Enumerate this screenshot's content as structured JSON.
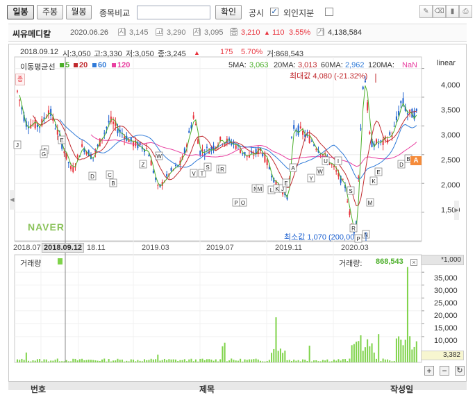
{
  "toolbar": {
    "period_daily": "일봉",
    "period_weekly": "주봉",
    "period_monthly": "월봉",
    "compare_label": "종목비교",
    "confirm_label": "확인",
    "disclosure_label": "공시",
    "foreign_label": "외인지분",
    "disclosure_check": "✓"
  },
  "info": {
    "stock_name": "씨유메디칼",
    "date": "2020.06.26",
    "open_badge": "시",
    "open": "3,145",
    "high_badge": "고",
    "high": "3,290",
    "low_badge": "저",
    "low": "3,095",
    "close_badge": "종",
    "close": "3,210",
    "change_arrow": "▲",
    "change": "110",
    "change_pct": "3.55%",
    "volume_badge": "거",
    "volume": "4,138,584"
  },
  "cursor_info": {
    "date": "2018.09.12",
    "open": "시:3,050",
    "high": "고:3,330",
    "low": "저:3,050",
    "close": "종:3,245",
    "arrow": "▲",
    "change": "175",
    "change_pct": "5.70%",
    "volume": "거:868,543"
  },
  "ma_legend": {
    "title": "이동평균선",
    "ma5": "5",
    "ma20": "20",
    "ma60": "60",
    "ma120": "120",
    "ma5_value_label": "5MA:",
    "ma5_value": "3,063",
    "ma20_value_label": "20MA:",
    "ma20_value": "3,013",
    "ma60_value_label": "60MA:",
    "ma60_value": "2,962",
    "ma120_value_label": "120MA:",
    "ma120_value": "NaN",
    "scale": "linear",
    "side_tab": "종"
  },
  "price_axis": {
    "ticks": [
      "4,000",
      "3,500",
      "3,000",
      "2,500",
      "2,000",
      "1,500"
    ],
    "last_price_marker": "A"
  },
  "annotations": {
    "max_label": "최대값 4,080 (-21.32%)",
    "min_label": "최소값 1,070 (200,00",
    "watermark": "NAVER"
  },
  "date_axis": {
    "labels": [
      "2018.07",
      "2018.09.12",
      "18.11",
      "2019.03",
      "2019.07",
      "2019.11",
      "2020.03"
    ]
  },
  "event_letters": [
    "J",
    "F",
    "G",
    "E",
    "D",
    "C",
    "B",
    "Z",
    "W",
    "V",
    "T",
    "S",
    "Q",
    "R",
    "P",
    "O",
    "N",
    "M",
    "L",
    "K",
    "J",
    "E",
    "A",
    "Y",
    "W",
    "U",
    "I",
    "S",
    "R",
    "P",
    "N",
    "M",
    "K",
    "E",
    "D",
    "B"
  ],
  "volume": {
    "title": "거래량",
    "value_label": "거래량:",
    "value": "868,543",
    "unit": "*1,000",
    "ticks": [
      "35,000",
      "30,000",
      "25,000",
      "20,000",
      "15,000",
      "10,000"
    ],
    "current": "3,382"
  },
  "zoom": {
    "plus": "+",
    "minus": "−",
    "reset": "↻"
  },
  "bottom": {
    "col1": "번호",
    "col2": "제목",
    "col3": "작성일"
  },
  "colors": {
    "up": "#e8323c",
    "down": "#1a5fd0",
    "ma5": "#4caf2a",
    "ma20": "#c0282d",
    "ma60": "#2f7ad8",
    "ma120": "#e83fa0",
    "volume": "#7fd34a"
  },
  "chart_data": {
    "type": "line",
    "series": [
      {
        "name": "5",
        "x": [
          "2018.07",
          "2018.09",
          "2018.11",
          "2019.01",
          "2019.03",
          "2019.05",
          "2019.07",
          "2019.09",
          "2019.11",
          "2020.01",
          "2020.03",
          "2020.05",
          "2020.06"
        ],
        "values": [
          3300,
          3150,
          2650,
          2550,
          3000,
          2850,
          2650,
          2200,
          2600,
          2700,
          1500,
          2700,
          3063
        ]
      },
      {
        "name": "20",
        "x": [
          "2018.07",
          "2018.09",
          "2018.11",
          "2019.01",
          "2019.03",
          "2019.05",
          "2019.07",
          "2019.09",
          "2019.11",
          "2020.01",
          "2020.03",
          "2020.05",
          "2020.06"
        ],
        "values": [
          3350,
          3100,
          2800,
          2500,
          2900,
          2900,
          2700,
          2300,
          2400,
          2700,
          1900,
          2600,
          3013
        ]
      },
      {
        "name": "60",
        "x": [
          "2018.09",
          "2018.11",
          "2019.01",
          "2019.03",
          "2019.05",
          "2019.07",
          "2019.09",
          "2019.11",
          "2020.01",
          "2020.03",
          "2020.05",
          "2020.06"
        ],
        "values": [
          3100,
          3000,
          2750,
          2700,
          2950,
          2800,
          2600,
          2350,
          2500,
          2500,
          2400,
          2962
        ]
      },
      {
        "name": "120",
        "x": [
          "2018.11",
          "2019.01",
          "2019.03",
          "2019.05",
          "2019.07",
          "2019.09",
          "2019.11",
          "2020.01",
          "2020.03",
          "2020.05",
          "2020.06"
        ],
        "values": [
          2950,
          2900,
          2850,
          2800,
          2750,
          2650,
          2500,
          2450,
          2400,
          2450,
          2500
        ]
      }
    ],
    "ylim": [
      1000,
      4200
    ],
    "yticks": [
      1500,
      2000,
      2500,
      3000,
      3500,
      4000
    ],
    "volume_ylim": [
      0,
      38000
    ],
    "volume_yticks": [
      10000,
      15000,
      20000,
      25000,
      30000,
      35000
    ]
  }
}
